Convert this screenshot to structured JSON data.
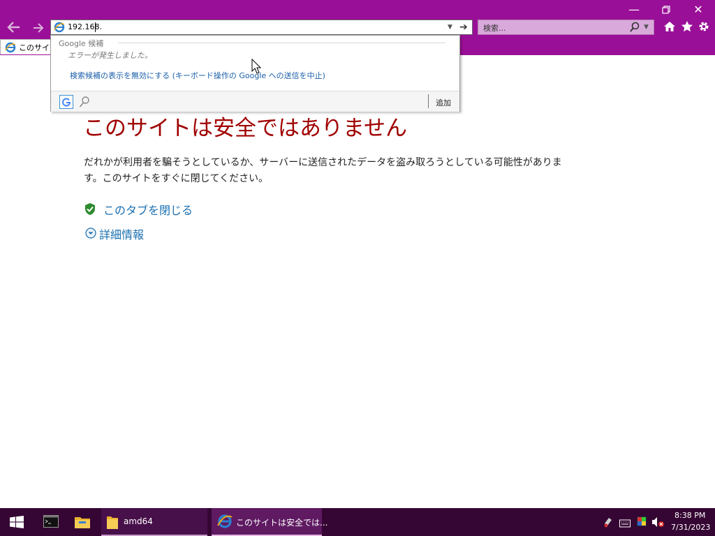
{
  "window": {
    "minimize_icon": "minimize-icon",
    "restore_icon": "restore-icon",
    "close_icon": "close-icon"
  },
  "toolbar": {
    "back_icon": "back-arrow-icon",
    "forward_icon": "forward-arrow-icon",
    "address_value": "192.168.",
    "go_icon": "go-arrow-icon",
    "search_placeholder": "検索...",
    "home_icon": "home-icon",
    "favorites_icon": "star-icon",
    "settings_icon": "gear-icon"
  },
  "tab": {
    "label": "このサイトは安全ではありません"
  },
  "suggestions": {
    "header": "Google 候補",
    "error": "エラーが発生しました。",
    "disable_link": "検索候補の表示を無効にする (キーボード操作の Google への送信を中止)",
    "add_label": "追加"
  },
  "page": {
    "title": "このサイトは安全ではありません",
    "body": "だれかが利用者を騙そうとしているか、サーバーに送信されたデータを盗み取ろうとしている可能性があります。このサイトをすぐに閉じてください。",
    "close_tab_link": "このタブを閉じる",
    "more_info_link": "詳細情報"
  },
  "taskbar": {
    "folder_label": "amd64",
    "ie_label": "このサイトは安全では...",
    "time": "8:38 PM",
    "date": "7/31/2023"
  },
  "colors": {
    "chrome": "#9a0f97",
    "taskbar": "#350633",
    "warning_title": "#a00000",
    "link": "#1a6fb0"
  }
}
